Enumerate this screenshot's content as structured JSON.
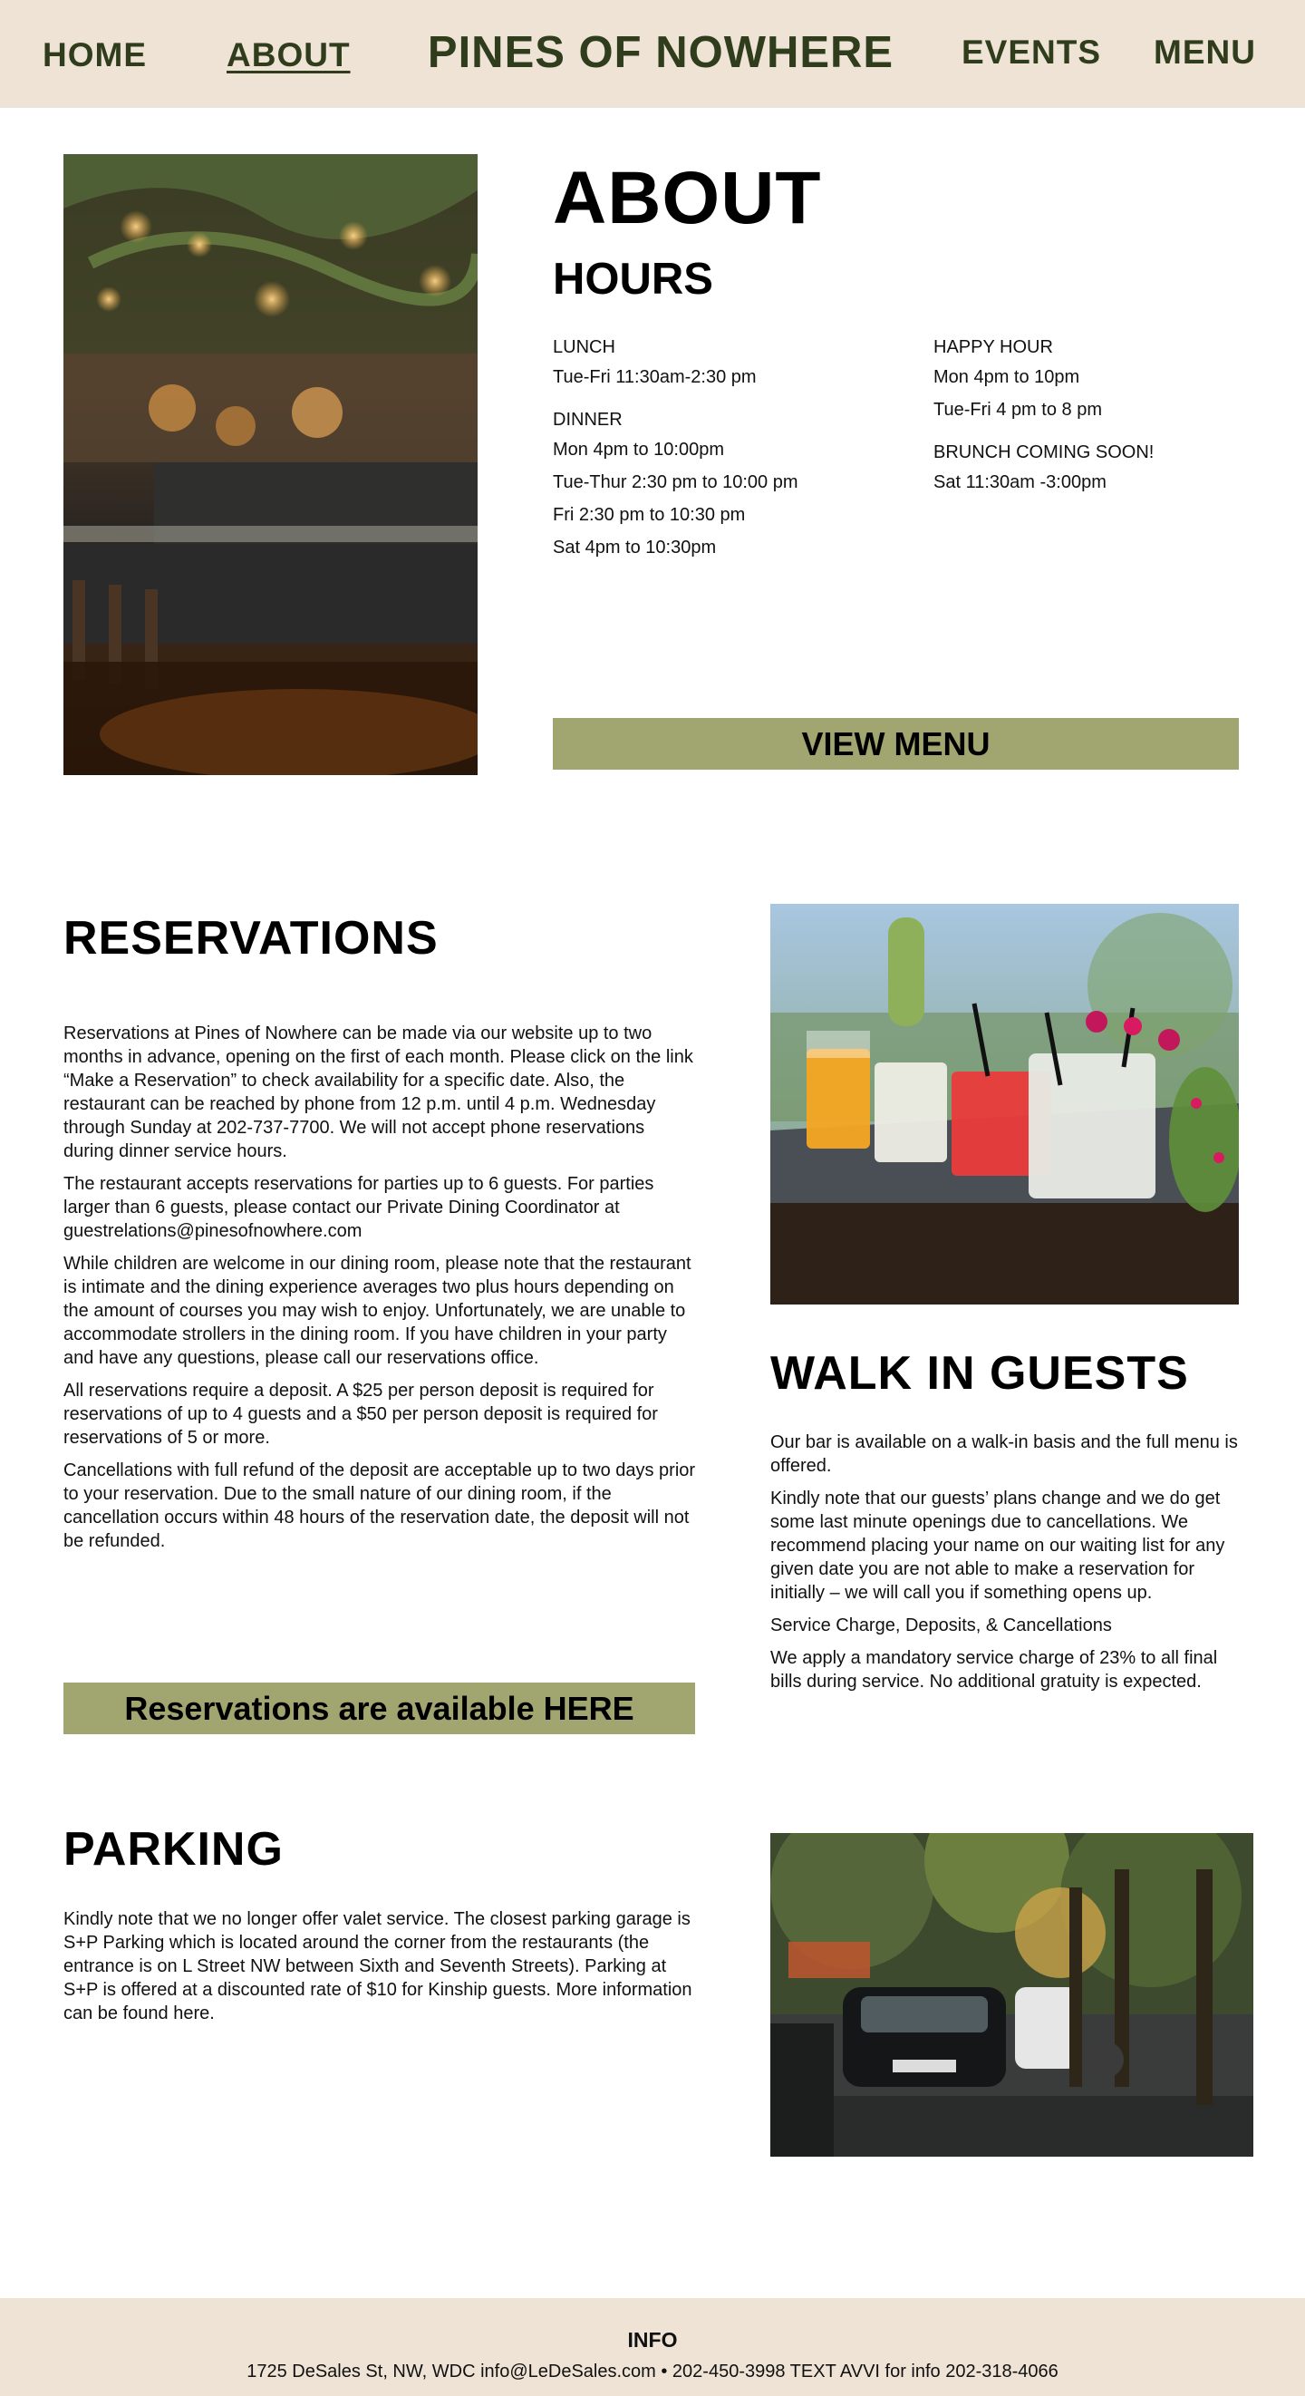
{
  "nav": {
    "home": "HOME",
    "about": "ABOUT",
    "brand": "PINES OF NOWHERE",
    "events": "EVENTS",
    "menu": "MENU"
  },
  "about": {
    "title": "ABOUT",
    "hours_title": "HOURS",
    "left_groups": [
      {
        "title": "LUNCH",
        "lines": [
          "Tue-Fri 11:30am-2:30 pm"
        ]
      },
      {
        "title": "DINNER",
        "lines": [
          "Mon 4pm to 10:00pm",
          "Tue-Thur 2:30 pm to 10:00 pm",
          "Fri 2:30 pm to 10:30 pm",
          "Sat 4pm to 10:30pm"
        ]
      }
    ],
    "right_groups": [
      {
        "title": "HAPPY HOUR",
        "lines": [
          "Mon 4pm to 10pm",
          "Tue-Fri 4 pm to 8 pm"
        ]
      },
      {
        "title": "BRUNCH COMING SOON!",
        "lines": [
          "Sat 11:30am -3:00pm"
        ]
      }
    ],
    "view_menu_label": "VIEW MENU"
  },
  "reservations": {
    "title": "RESERVATIONS",
    "paragraphs": [
      "Reservations at Pines of Nowhere can be made via our website up to two months in advance, opening on the first of each month. Please click on the link “Make a Reservation” to check availability for a specific date. Also, the restaurant can be reached by phone from 12 p.m. until 4 p.m. Wednesday through Sunday at 202-737-7700. We will not accept phone reservations during dinner service hours.",
      "The restaurant accepts reservations for parties up to 6 guests. For parties larger than 6 guests, please contact our Private Dining Coordinator at guestrelations@pinesofnowhere.com",
      "While children are welcome in our dining room, please note that the restaurant is intimate and the dining experience averages two plus hours depending on the amount of courses you may wish to enjoy. Unfortunately, we are unable to accommodate strollers in the dining room. If you have children in your party and have any questions, please call our reservations office.",
      "All reservations require a deposit. A $25 per person deposit is required for reservations of up to 4 guests and a $50 per person deposit is required for reservations of 5 or more.",
      "Cancellations with full refund of the deposit are acceptable up to two days prior to your reservation. Due to the small nature of our dining room, if the cancellation occurs within 48 hours of the reservation date, the deposit will not be refunded."
    ],
    "cta_label": "Reservations are available HERE"
  },
  "walk_in": {
    "title": "WALK IN GUESTS",
    "paragraphs": [
      "Our bar is available on a walk-in basis and the full menu is offered.",
      "Kindly note that our guests’ plans change and we do get some last minute openings due to cancellations. We recommend placing your name on our waiting list for any given date you are not able to make a reservation for initially – we will call you if something opens up.",
      "Service Charge, Deposits, & Cancellations",
      "We apply a mandatory service charge of 23% to all final bills during service. No additional gratuity is expected."
    ]
  },
  "parking": {
    "title": "PARKING",
    "paragraph": "Kindly note that we no longer offer valet service. The closest parking garage is S+P Parking which is located around the corner from the restaurants (the entrance is on L Street NW between Sixth and Seventh Streets). Parking at S+P is offered at a discounted rate of $10 for Kinship guests. More information can be found here."
  },
  "footer": {
    "title": "INFO",
    "line": "1725 DeSales St, NW, WDC  info@LeDeSales.com • 202-450-3998  TEXT AVVI for info  202-318-4066"
  },
  "colors": {
    "header_bg": "#efe3d6",
    "nav_text": "#2f3d1d",
    "button_bg": "#a1a56f",
    "footer_bg": "#efe3d6"
  }
}
